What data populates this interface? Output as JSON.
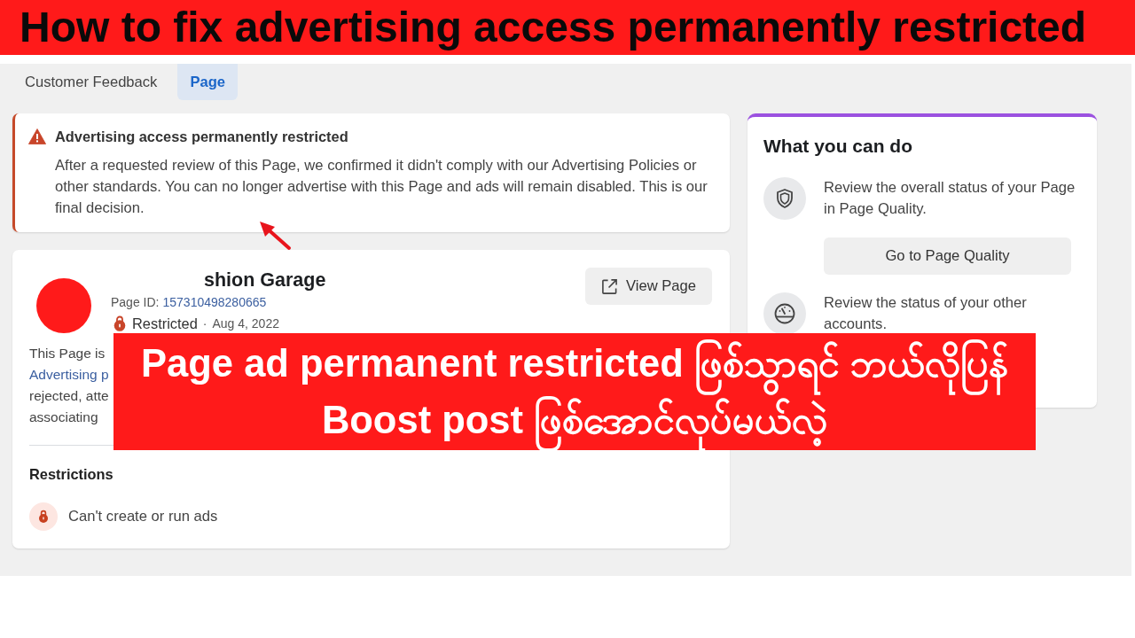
{
  "thumbnail_title": "How to fix advertising access permanently restricted",
  "tabs": [
    {
      "label": "Customer Feedback",
      "selected": false
    },
    {
      "label": "Page",
      "selected": true
    }
  ],
  "alert": {
    "title": "Advertising access permanently restricted",
    "message": "After a requested review of this Page, we confirmed it didn't comply with our Advertising Policies or other standards. You can no longer advertise with this Page and ads will remain disabled. This is our final decision."
  },
  "page_card": {
    "name": "shion Garage",
    "page_id_label": "Page ID:",
    "page_id": "157310498280665",
    "status": "Restricted",
    "separator": "·",
    "date": "Aug 4, 2022",
    "view_button": "View Page",
    "description_lines": [
      {
        "kind": "text",
        "text": "This Page is"
      },
      {
        "kind": "link",
        "text": "Advertising p"
      },
      {
        "kind": "text",
        "text": "rejected, atte"
      },
      {
        "kind": "text",
        "text": "associating"
      }
    ],
    "restrictions_title": "Restrictions",
    "restrictions": [
      "Can't create or run ads"
    ]
  },
  "side_panel": {
    "title": "What you can do",
    "items": [
      {
        "kind": "quality",
        "text": "Review the overall status of your Page in Page Quality.",
        "button": "Go to Page Quality"
      },
      {
        "kind": "accounts",
        "text": "Review the status of your other accounts."
      }
    ]
  },
  "caption_banner": {
    "lines": [
      "Page ad permanent restricted ဖြစ်သွာရင် ဘယ်လိုပြန်",
      "Boost post ဖြစ်အောင်လုပ်မယ်လဲ့"
    ]
  }
}
